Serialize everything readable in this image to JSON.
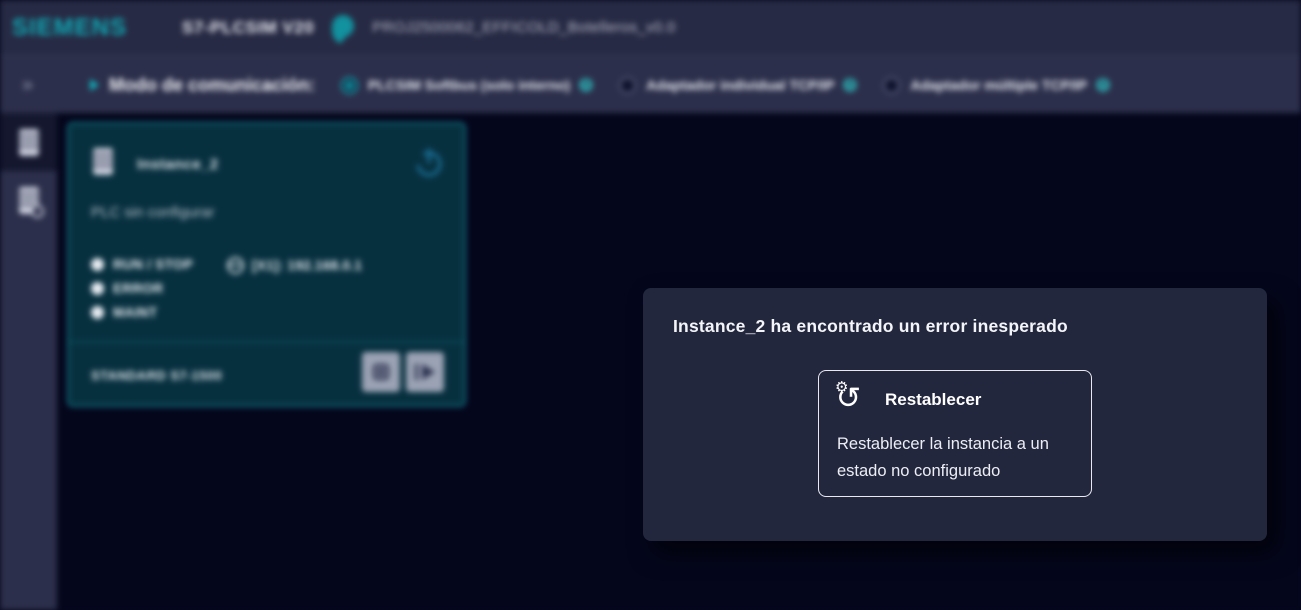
{
  "titlebar": {
    "brand": "SIEMENS",
    "app_title": "S7-PLCSIM V20",
    "project_name": "PROJ2500062_EFFICOLD_Botelleros_v0.0"
  },
  "toolbar": {
    "collapse_icon": "»",
    "label": "Modo de comunicación:",
    "options": [
      {
        "label": "PLCSIM Softbus (solo interno)",
        "selected": true
      },
      {
        "label": "Adaptador individual TCP/IP",
        "selected": false
      },
      {
        "label": "Adaptador múltiple TCP/IP",
        "selected": false
      }
    ]
  },
  "instance_card": {
    "name": "Instance_2",
    "status_text": "PLC sin configurar",
    "leds": [
      {
        "label": "RUN / STOP"
      },
      {
        "label": "ERROR"
      },
      {
        "label": "MAINT"
      }
    ],
    "interface": "[X1]: 192.168.0.1",
    "model": "STANDARD S7-1500"
  },
  "dialog": {
    "title": "Instance_2 ha encontrado un error inesperado",
    "action": {
      "icon_arrow": "↺",
      "icon_gear": "⚙",
      "label": "Restablecer",
      "description": "Restablecer la instancia a un estado no configurado"
    }
  },
  "colors": {
    "accent_teal": "#11b5c0",
    "card_border": "#116e7e",
    "dialog_bg": "#23273e",
    "topbar_bg": "#272a44",
    "main_bg": "#04061c"
  }
}
